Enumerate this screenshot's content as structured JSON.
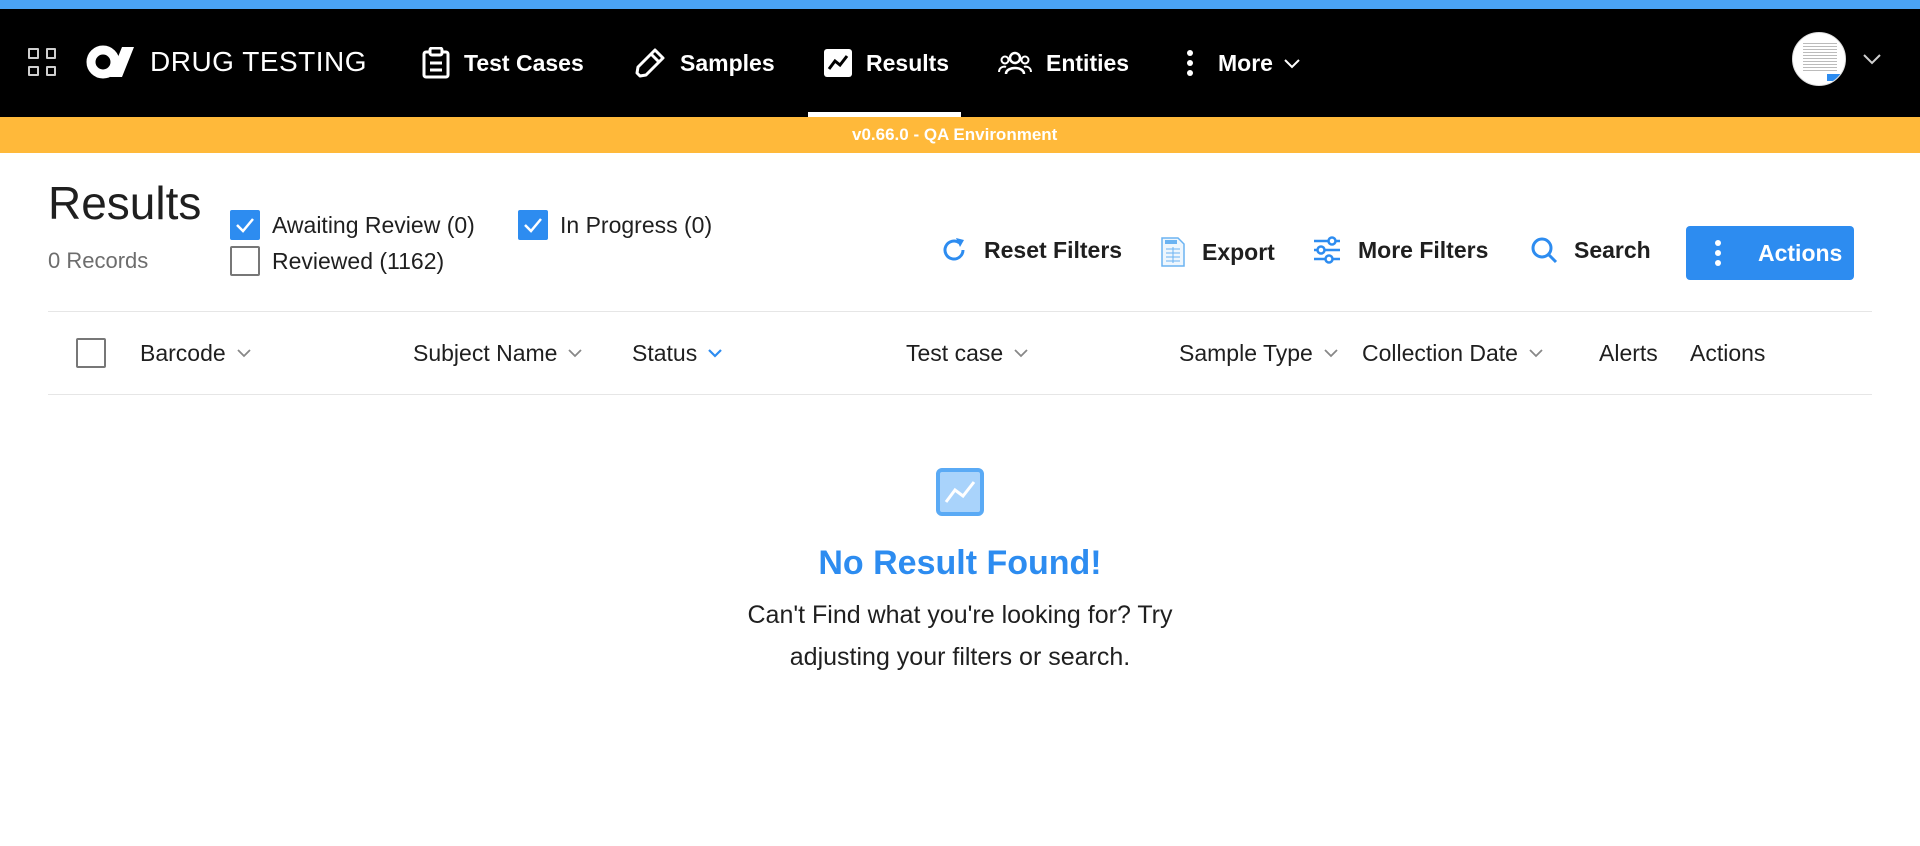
{
  "colors": {
    "accent": "#2d8cf0",
    "env_bar": "#ffb93a",
    "nav_bg": "#000000",
    "top_accent": "#4aa3f5"
  },
  "app": {
    "brand": "DRUG TESTING",
    "logo_icon": "company-logo"
  },
  "nav": {
    "items": [
      {
        "label": "Test Cases",
        "icon": "clipboard-icon"
      },
      {
        "label": "Samples",
        "icon": "pipette-icon"
      },
      {
        "label": "Results",
        "icon": "chart-icon",
        "active": true
      },
      {
        "label": "Entities",
        "icon": "users-icon"
      },
      {
        "label": "More",
        "icon": "vertical-dots-icon"
      }
    ]
  },
  "environment": {
    "label": "v0.66.0 - QA Environment"
  },
  "page": {
    "title": "Results",
    "records": "0 Records"
  },
  "filters": {
    "awaiting_review": {
      "label": "Awaiting Review (0)",
      "checked": true
    },
    "in_progress": {
      "label": "In Progress (0)",
      "checked": true
    },
    "reviewed": {
      "label": "Reviewed (1162)",
      "checked": false
    }
  },
  "toolbar": {
    "reset_filters": "Reset Filters",
    "export": "Export",
    "more_filters": "More Filters",
    "search": "Search",
    "actions": "Actions"
  },
  "table": {
    "columns": [
      "Barcode",
      "Subject Name",
      "Status",
      "Test case",
      "Sample Type",
      "Collection Date",
      "Alerts",
      "Actions"
    ]
  },
  "empty_state": {
    "title": "No Result Found!",
    "message": "Can't Find what you're looking for? Try adjusting your filters or search."
  }
}
